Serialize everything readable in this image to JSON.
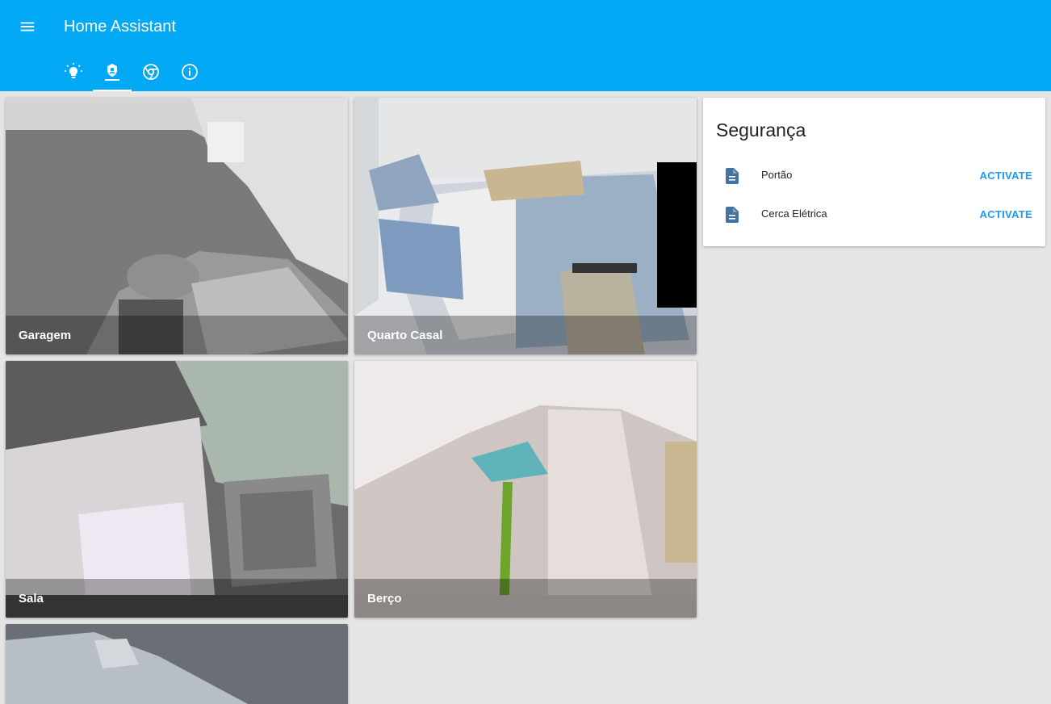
{
  "app": {
    "title": "Home Assistant"
  },
  "header": {
    "menu_icon": "hamburger-menu-icon",
    "tabs": [
      {
        "icon": "lightbulb-icon",
        "active": false
      },
      {
        "icon": "security-cctv-icon",
        "active": true
      },
      {
        "icon": "chrome-icon",
        "active": false
      },
      {
        "icon": "info-icon",
        "active": false
      }
    ]
  },
  "cameras": [
    {
      "name": "Garagem"
    },
    {
      "name": "Quarto Casal"
    },
    {
      "name": "Sala"
    },
    {
      "name": "Berço"
    },
    {
      "name": ""
    }
  ],
  "card": {
    "title": "Segurança",
    "items": [
      {
        "icon": "script-document-icon",
        "name": "Portão",
        "action": "ACTIVATE"
      },
      {
        "icon": "script-document-icon",
        "name": "Cerca Elétrica",
        "action": "ACTIVATE"
      }
    ]
  },
  "colors": {
    "accent": "#03a9f4",
    "action": "#2196f3",
    "icon": "#44739e",
    "background": "#e5e5e5"
  }
}
